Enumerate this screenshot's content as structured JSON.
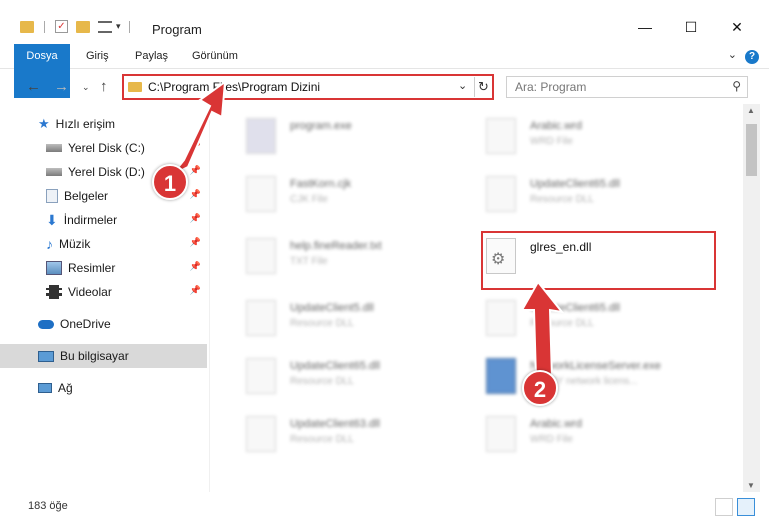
{
  "window": {
    "title": "Program",
    "minimize": "—",
    "maximize": "☐",
    "close": "✕"
  },
  "ribbon": {
    "tabs": [
      "Dosya",
      "Giriş",
      "Paylaş",
      "Görünüm"
    ],
    "help": "?"
  },
  "address": {
    "path": "C:\\Program Files\\Program Dizini",
    "search_placeholder": "Ara: Program"
  },
  "sidebar": {
    "quick_access": "Hızlı erişim",
    "items": [
      {
        "label": "Yerel Disk (C:)",
        "icon": "drive-icon"
      },
      {
        "label": "Yerel Disk (D:)",
        "icon": "drive-icon"
      },
      {
        "label": "Belgeler",
        "icon": "documents-icon"
      },
      {
        "label": "İndirmeler",
        "icon": "download-icon"
      },
      {
        "label": "Müzik",
        "icon": "music-icon"
      },
      {
        "label": "Resimler",
        "icon": "pictures-icon"
      },
      {
        "label": "Videolar",
        "icon": "video-icon"
      }
    ],
    "onedrive": "OneDrive",
    "this_pc": "Bu bilgisayar",
    "network": "Ağ"
  },
  "files": [
    {
      "name": "program.exe",
      "type": ""
    },
    {
      "name": "Arabic.wrd",
      "type": "WRD File"
    },
    {
      "name": "FastKorn.cjk",
      "type": "CJK File"
    },
    {
      "name": "UpdateClient65.dll",
      "type": "Resource DLL"
    },
    {
      "name": "help.fineReader.txt",
      "type": "TXT File"
    },
    {
      "name": "glres_en.dll",
      "type": ""
    },
    {
      "name": "UpdateClient5.dll",
      "type": "Resource DLL"
    },
    {
      "name": "UpdateClient65.dll",
      "type": "Resource DLL"
    },
    {
      "name": "UpdateClient65.dll",
      "type": "Resource DLL"
    },
    {
      "name": "NetworkLicenseServer.exe",
      "type": "ABBYY network licens..."
    },
    {
      "name": "UpdateClient63.dll",
      "type": "Resource DLL"
    },
    {
      "name": "Arabic.wrd",
      "type": "WRD File"
    }
  ],
  "status": {
    "item_count": "183 öğe"
  },
  "annotations": {
    "step1": "1",
    "step2": "2",
    "color": "#d93535"
  }
}
